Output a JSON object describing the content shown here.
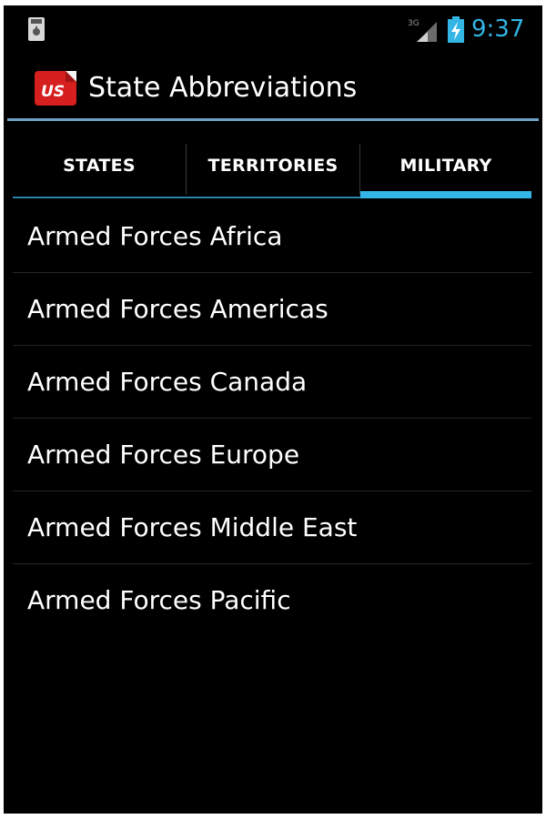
{
  "status_bar": {
    "left_icon": "sd-card-usb-icon",
    "network_label": "3G",
    "signal_icon": "cell-signal-icon",
    "battery_icon": "battery-charging-icon",
    "time": "9:37",
    "time_color": "#33b5e5"
  },
  "action_bar": {
    "app_icon": "us-flag-icon",
    "app_icon_text": "US",
    "title": "State Abbreviations"
  },
  "tabs": [
    {
      "label": "STATES",
      "selected": false
    },
    {
      "label": "TERRITORIES",
      "selected": false
    },
    {
      "label": "MILITARY",
      "selected": true
    }
  ],
  "accent_color": "#33b5e5",
  "list": {
    "items": [
      {
        "label": "Armed Forces Africa"
      },
      {
        "label": "Armed Forces Americas"
      },
      {
        "label": "Armed Forces Canada"
      },
      {
        "label": "Armed Forces Europe"
      },
      {
        "label": "Armed Forces Middle East"
      },
      {
        "label": "Armed Forces Pacific"
      }
    ]
  }
}
